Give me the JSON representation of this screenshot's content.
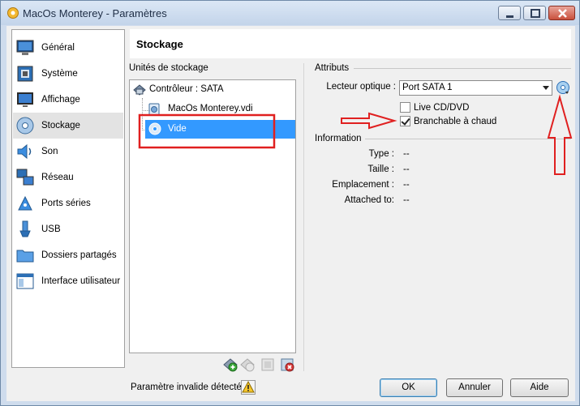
{
  "window": {
    "title": "MacOs Monterey - Paramètres"
  },
  "sidebar": {
    "items": [
      {
        "label": "Général",
        "icon": "general-icon"
      },
      {
        "label": "Système",
        "icon": "system-icon"
      },
      {
        "label": "Affichage",
        "icon": "display-icon"
      },
      {
        "label": "Stockage",
        "icon": "storage-icon",
        "active": true
      },
      {
        "label": "Son",
        "icon": "sound-icon"
      },
      {
        "label": "Réseau",
        "icon": "network-icon"
      },
      {
        "label": "Ports séries",
        "icon": "serial-ports-icon"
      },
      {
        "label": "USB",
        "icon": "usb-icon"
      },
      {
        "label": "Dossiers partagés",
        "icon": "shared-folders-icon"
      },
      {
        "label": "Interface utilisateur",
        "icon": "user-interface-icon"
      }
    ]
  },
  "header": {
    "title": "Stockage"
  },
  "storage": {
    "section_title": "Unités de stockage",
    "controller": "Contrôleur : SATA",
    "disk": "MacOs Monterey.vdi",
    "optical": "Vide"
  },
  "attributes": {
    "section_title": "Attributs",
    "drive_label": "Lecteur optique :",
    "drive_value": "Port SATA 1",
    "live_cd_label": "Live CD/DVD",
    "live_cd_checked": false,
    "hotplug_label": "Branchable à chaud",
    "hotplug_checked": true
  },
  "information": {
    "section_title": "Information",
    "rows": [
      {
        "label": "Type :",
        "value": "--"
      },
      {
        "label": "Taille :",
        "value": "--"
      },
      {
        "label": "Emplacement :",
        "value": "--"
      },
      {
        "label": "Attached to:",
        "value": "--"
      }
    ]
  },
  "footer": {
    "status": "Paramètre invalide détecté",
    "ok_label": "OK",
    "cancel_label": "Annuler",
    "help_label": "Aide"
  },
  "colors": {
    "selection": "#3399ff",
    "annotation": "#e02020"
  }
}
